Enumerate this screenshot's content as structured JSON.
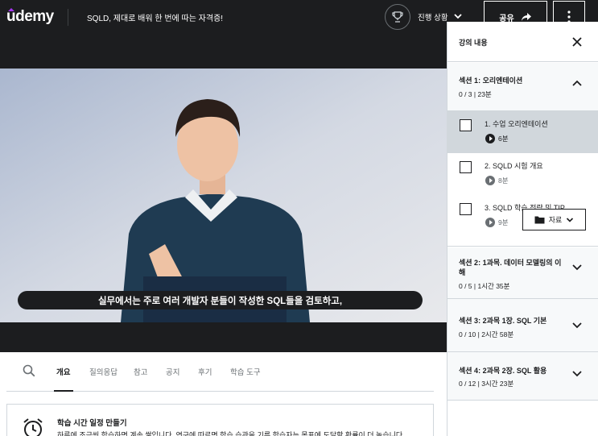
{
  "header": {
    "logo": "udemy",
    "course_title": "SQLD, 제대로 배워 한 번에 따는 자격증!",
    "progress_label": "진행 상황",
    "share_label": "공유"
  },
  "video": {
    "subtitle": "실무에서는 주로 여러 개발자 분들이 작성한 SQL들을 검토하고,"
  },
  "tabs": {
    "items": [
      "개요",
      "질의응답",
      "참고",
      "공지",
      "후기",
      "학습 도구"
    ],
    "active": "개요"
  },
  "reminder": {
    "title": "학습 시간 일정 만들기",
    "text": "하루에 조금씩 학습하면 계속 쌓입니다. 연구에 따르면 학습 습관을 기른 학습자는 목표에 도달할 확률이 더 높습니다"
  },
  "sidebar": {
    "title": "강의 내용",
    "sections": [
      {
        "title": "섹션 1: 오리엔테이션",
        "meta": "0 / 3 | 23분",
        "expanded": true,
        "lectures": [
          {
            "title": "1. 수업 오리엔테이션",
            "duration": "6분",
            "current": true
          },
          {
            "title": "2. SQLD 시험 개요",
            "duration": "8분",
            "current": false
          },
          {
            "title": "3. SQLD 학습 전략 및 TIP",
            "duration": "9분",
            "current": false,
            "resources_label": "자료"
          }
        ]
      },
      {
        "title": "섹션 2: 1과목. 데이터 모델링의 이해",
        "meta": "0 / 5 | 1시간 35분",
        "expanded": false
      },
      {
        "title": "섹션 3: 2과목 1장. SQL 기본",
        "meta": "0 / 10 | 2시간 58분",
        "expanded": false
      },
      {
        "title": "섹션 4: 2과목 2장. SQL 활용",
        "meta": "0 / 12 | 3시간 23분",
        "expanded": false
      }
    ]
  },
  "colors": {
    "header_bg": "#1c1d1f",
    "brand_accent": "#a435f0",
    "current_lecture_bg": "#d1d7dc",
    "section_bg": "#f7f9fa"
  },
  "icons": [
    "trophy-icon",
    "chevron-down-icon",
    "share-arrow-icon",
    "more-vertical-icon",
    "search-icon",
    "alarm-clock-icon",
    "close-icon",
    "chevron-up-icon",
    "play-icon",
    "folder-icon"
  ]
}
